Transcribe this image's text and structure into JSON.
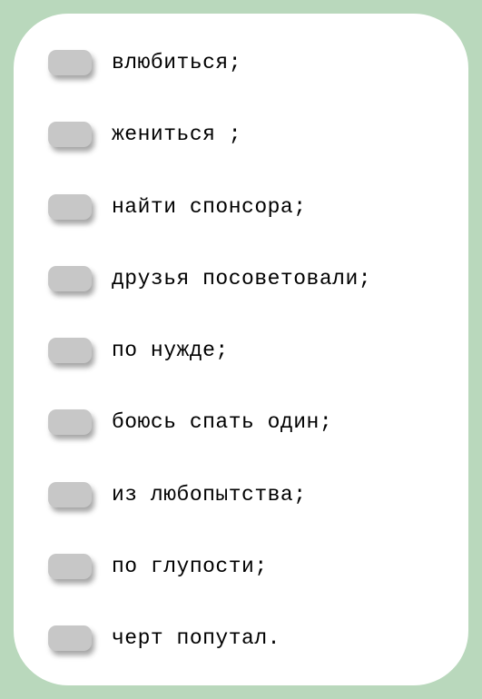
{
  "items": [
    {
      "label": "влюбиться;"
    },
    {
      "label": "жениться ;"
    },
    {
      "label": "найти спонсора;"
    },
    {
      "label": "друзья посоветовали;"
    },
    {
      "label": "по нужде;"
    },
    {
      "label": "боюсь спать один;"
    },
    {
      "label": "из любопытства;"
    },
    {
      "label": "по глупости;"
    },
    {
      "label": "черт попутал."
    }
  ]
}
